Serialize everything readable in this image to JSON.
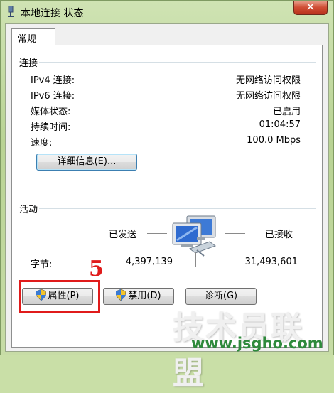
{
  "window": {
    "title": "本地连接 状态",
    "close_label": "✕"
  },
  "tabs": [
    {
      "label": "常规"
    }
  ],
  "connection": {
    "group_label": "连接",
    "rows": [
      {
        "label": "IPv4 连接:",
        "value": "无网络访问权限"
      },
      {
        "label": "IPv6 连接:",
        "value": "无网络访问权限"
      },
      {
        "label": "媒体状态:",
        "value": "已启用"
      },
      {
        "label": "持续时间:",
        "value": "01:04:57"
      },
      {
        "label": "速度:",
        "value": "100.0 Mbps"
      }
    ],
    "details_button": "详细信息(E)..."
  },
  "activity": {
    "group_label": "活动",
    "sent_label": "已发送",
    "received_label": "已接收",
    "bytes_label": "字节:",
    "bytes_sent": "4,397,139",
    "bytes_received": "31,493,601",
    "icon": "network-computers-icon"
  },
  "buttons": {
    "properties": "属性(P)",
    "disable": "禁用(D)",
    "diagnose": "诊断(G)"
  },
  "annotation": {
    "number": "5",
    "color": "#e01b1b"
  },
  "watermark": {
    "text": "技术员联盟",
    "url": "www.jsgho.com",
    "color": "#2f8a3c"
  }
}
